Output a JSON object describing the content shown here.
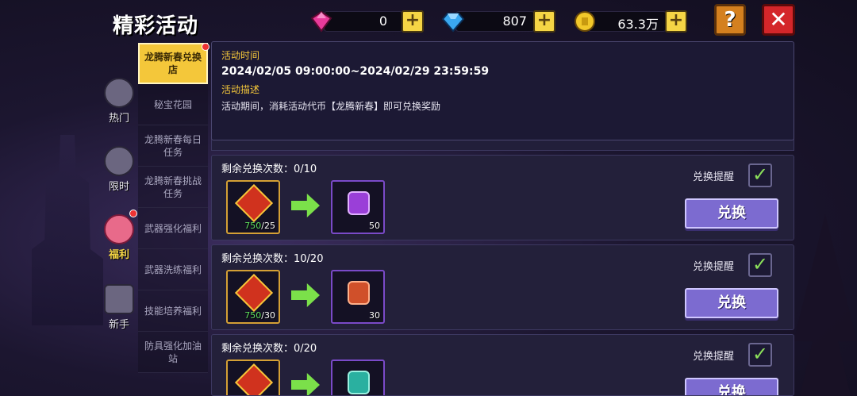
{
  "title": "精彩活动",
  "currency": {
    "pink_gem": "0",
    "blue_gem": "807",
    "gold": "63.3万"
  },
  "categories": [
    {
      "label": "热门",
      "icon": "ghost-icon"
    },
    {
      "label": "限时",
      "icon": "clock-icon"
    },
    {
      "label": "福利",
      "icon": "gift-bag-icon"
    },
    {
      "label": "新手",
      "icon": "helmet-icon"
    }
  ],
  "subtabs": [
    "龙腾新春兑换店",
    "秘宝花园",
    "龙腾新春每日任务",
    "龙腾新春挑战任务",
    "武器强化福利",
    "武器洗练福利",
    "技能培养福利",
    "防具强化加油站"
  ],
  "info": {
    "time_label": "活动时间",
    "time_value": "2024/02/05 09:00:00~2024/02/29 23:59:59",
    "desc_label": "活动描述",
    "desc_value": "活动期间，消耗活动代币【龙腾新春】即可兑换奖励"
  },
  "rows": [
    {
      "remaining": "剩余兑换次数：0/10",
      "cost_have": "750",
      "cost_need": "/25",
      "reward_qty": "50",
      "reward_color": "#9a3fd8",
      "remind": "兑换提醒",
      "button": "兑换"
    },
    {
      "remaining": "剩余兑换次数：10/20",
      "cost_have": "750",
      "cost_need": "/30",
      "reward_qty": "30",
      "reward_color": "#d0502a",
      "remind": "兑换提醒",
      "button": "兑换"
    },
    {
      "remaining": "剩余兑换次数：0/20",
      "cost_have": "",
      "cost_need": "",
      "reward_qty": "",
      "reward_color": "#2ab0a0",
      "remind": "兑换提醒",
      "button": "兑换"
    }
  ],
  "help": "?",
  "close": "✕",
  "check_mark": "✓"
}
